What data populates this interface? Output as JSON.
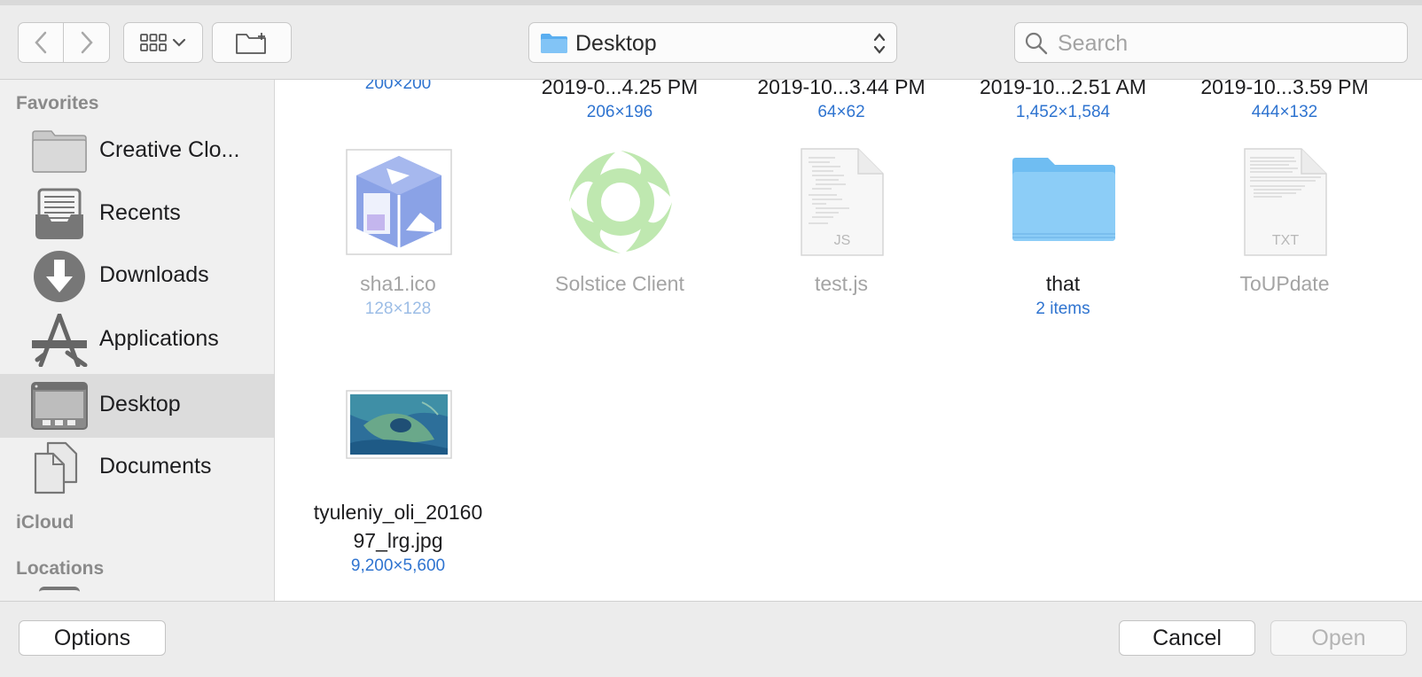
{
  "toolbar": {
    "location": "Desktop",
    "search_placeholder": "Search"
  },
  "sidebar": {
    "sections": {
      "favorites": "Favorites",
      "icloud": "iCloud",
      "locations": "Locations"
    },
    "items": [
      {
        "label": "Creative Clo...",
        "icon": "folder-icon"
      },
      {
        "label": "Recents",
        "icon": "recents-icon"
      },
      {
        "label": "Downloads",
        "icon": "downloads-icon"
      },
      {
        "label": "Applications",
        "icon": "applications-icon"
      },
      {
        "label": "Desktop",
        "icon": "desktop-icon",
        "selected": true
      },
      {
        "label": "Documents",
        "icon": "documents-icon"
      }
    ]
  },
  "files": {
    "row0": [
      {
        "name": "",
        "sub": "200×200"
      },
      {
        "name": "2019-0...4.25 PM",
        "sub": "206×196"
      },
      {
        "name": "2019-10...3.44 PM",
        "sub": "64×62"
      },
      {
        "name": "2019-10...2.51 AM",
        "sub": "1,452×1,584"
      },
      {
        "name": "2019-10...3.59 PM",
        "sub": "444×132"
      }
    ],
    "row1": [
      {
        "name": "sha1.ico",
        "sub": "128×128",
        "dim": true
      },
      {
        "name": "Solstice Client",
        "sub": "",
        "dim": true
      },
      {
        "name": "test.js",
        "sub": "",
        "dim": true,
        "badge": "JS"
      },
      {
        "name": "that",
        "sub": "2 items",
        "dim": false
      },
      {
        "name": "ToUPdate",
        "sub": "",
        "dim": true,
        "badge": "TXT"
      }
    ],
    "row2": [
      {
        "name_line1": "tyuleniy_oli_20160",
        "name_line2": "97_lrg.jpg",
        "sub": "9,200×5,600"
      }
    ]
  },
  "buttons": {
    "options": "Options",
    "cancel": "Cancel",
    "open": "Open"
  },
  "colors": {
    "accent_blue": "#2f74d0",
    "selected_row": "#dcdcdc",
    "toolbar_bg": "#ececec"
  }
}
